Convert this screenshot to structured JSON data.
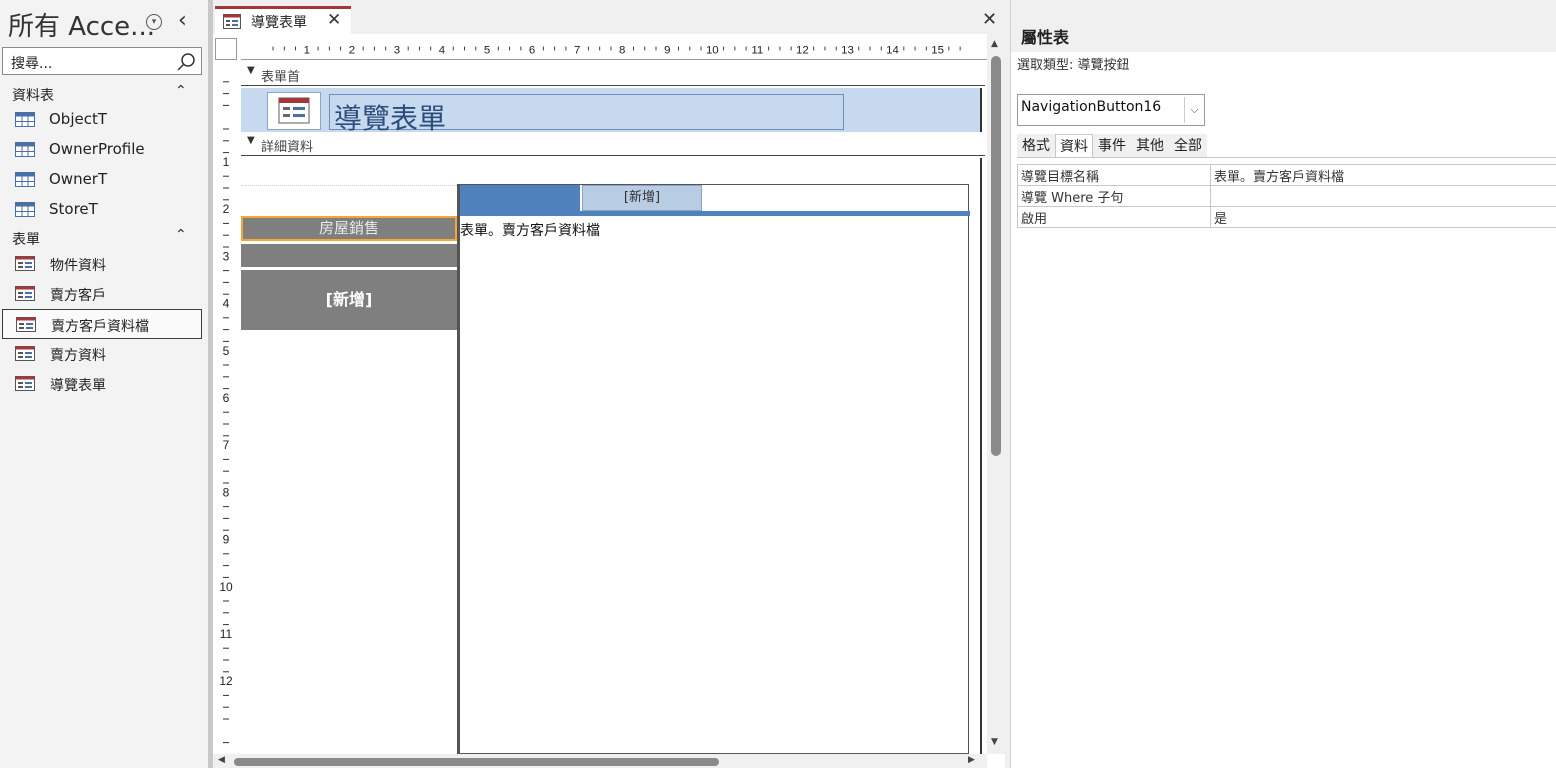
{
  "nav": {
    "title": "所有 Acce...",
    "dropdown_glyph": "▾",
    "close_glyph": "‹",
    "search_placeholder": "搜尋...",
    "groups": [
      {
        "label": "資料表",
        "items": [
          "ObjectT",
          "OwnerProfile",
          "OwnerT",
          "StoreT"
        ]
      },
      {
        "label": "表單",
        "items": [
          "物件資料",
          "賣方客戶",
          "賣方客戶資料檔",
          "賣方資料",
          "導覽表單"
        ]
      }
    ],
    "selected_item": "賣方客戶資料檔"
  },
  "doc": {
    "tab_label": "導覽表單",
    "tab_close": "✕",
    "window_close": "✕",
    "ruler_numbers": [
      "1",
      "2",
      "3",
      "4",
      "5",
      "6",
      "7",
      "8",
      "9",
      "10",
      "11",
      "12",
      "13",
      "14",
      "15"
    ],
    "vruler_numbers": [
      "1",
      "2",
      "3",
      "4",
      "5",
      "6",
      "7",
      "8",
      "9",
      "10",
      "11",
      "12"
    ],
    "sections": {
      "header": "表單首",
      "detail": "詳細資料"
    },
    "form_title": "導覽表單",
    "top_tabs": [
      "",
      "[新增]"
    ],
    "subform_source": "表單。賣方客戶資料檔",
    "side_tabs": [
      "房屋銷售",
      "",
      "[新增]"
    ]
  },
  "props": {
    "title": "屬性表",
    "selection_type": "選取類型: 導覽按鈕",
    "selected_control": "NavigationButton16",
    "tabs": [
      "格式",
      "資料",
      "事件",
      "其他",
      "全部"
    ],
    "active_tab": "資料",
    "rows": [
      {
        "key": "導覽目標名稱",
        "value": "表單。賣方客戶資料檔"
      },
      {
        "key": "導覽 Where 子句",
        "value": ""
      },
      {
        "key": "啟用",
        "value": "是"
      }
    ]
  },
  "colors": {
    "accent_tab": "#a4373a",
    "band": "#c6d9ee",
    "nav_blue": "#4f81bd",
    "nav_gray": "#7f7f7f",
    "focus": "#f4a636"
  }
}
